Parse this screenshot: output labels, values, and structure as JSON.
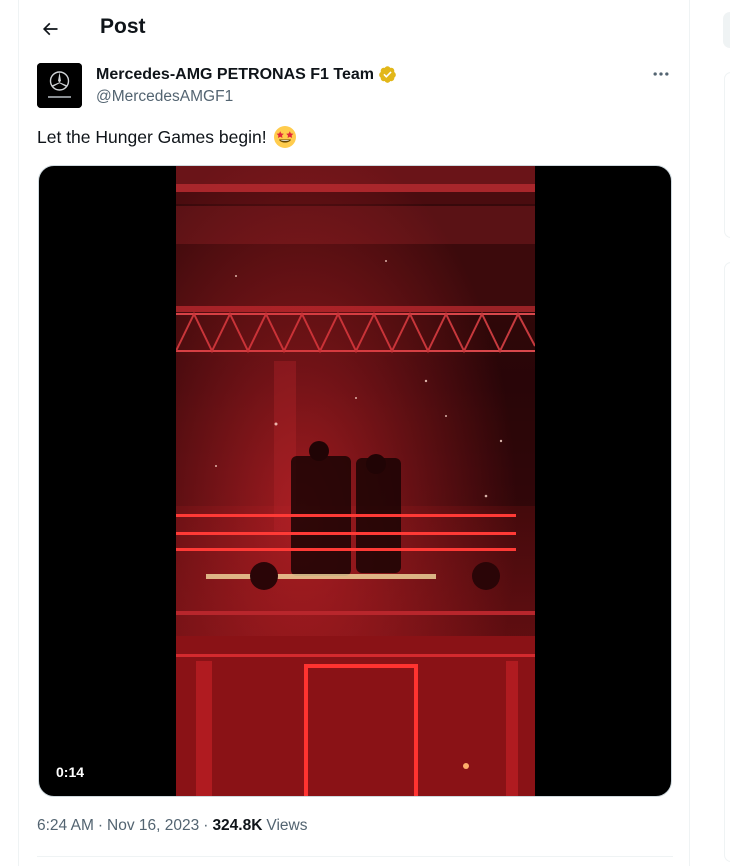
{
  "header": {
    "title": "Post",
    "back_icon": "arrow-left-icon"
  },
  "tweet": {
    "author": {
      "name": "Mercedes-AMG PETRONAS F1 Team",
      "handle": "@MercedesAMGF1",
      "verified": true,
      "verified_color": "#e2b719",
      "avatar_logo_text": "AMG"
    },
    "text": "Let the Hunger Games begin!",
    "text_emoji": "star-struck-emoji",
    "media": {
      "type": "video",
      "duration": "0:14"
    },
    "time": "6:24 AM",
    "date": "Nov 16, 2023",
    "separator": "·",
    "views_count": "324.8K",
    "views_label": "Views"
  },
  "colors": {
    "text_primary": "#0f1419",
    "text_secondary": "#536471",
    "border": "#eff3f4",
    "video_red": "#c81b22"
  }
}
